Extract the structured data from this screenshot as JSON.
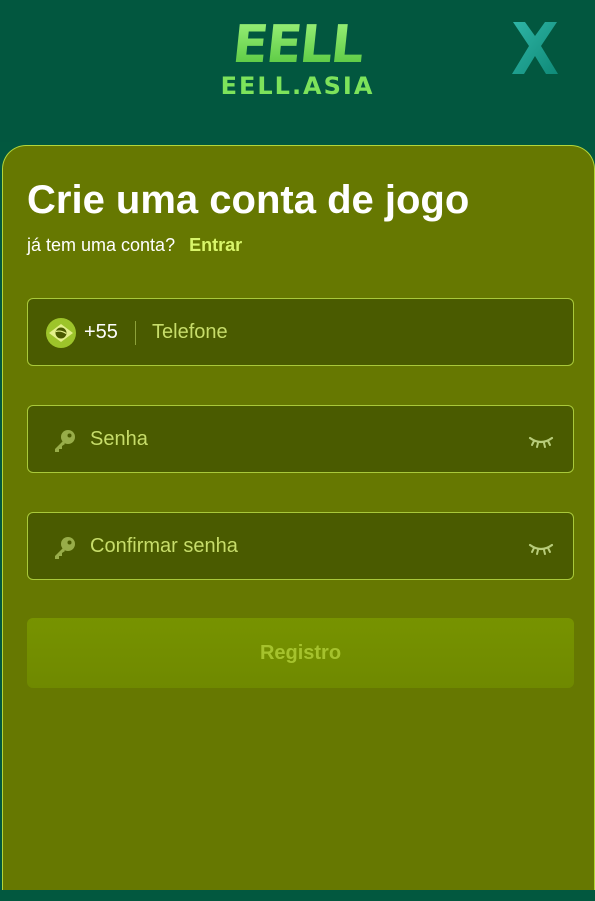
{
  "header": {
    "logo_mark": "EELL",
    "logo_sub": "EELL.ASIA"
  },
  "form": {
    "title": "Crie uma conta de jogo",
    "have_account_text": "já tem uma conta?",
    "login_link": "Entrar",
    "phone": {
      "country_code": "+55",
      "placeholder": "Telefone"
    },
    "password": {
      "placeholder": "Senha"
    },
    "confirm_password": {
      "placeholder": "Confirmar senha"
    },
    "submit_label": "Registro"
  },
  "colors": {
    "header_bg": "#02573f",
    "card_bg": "#667801",
    "field_bg": "#4a5b00",
    "accent": "#d8f56a",
    "button_bg": "#779300"
  },
  "icons": {
    "close": "close-icon",
    "flag": "brazil-flag-icon",
    "key": "key-icon",
    "eye": "eye-closed-icon"
  }
}
